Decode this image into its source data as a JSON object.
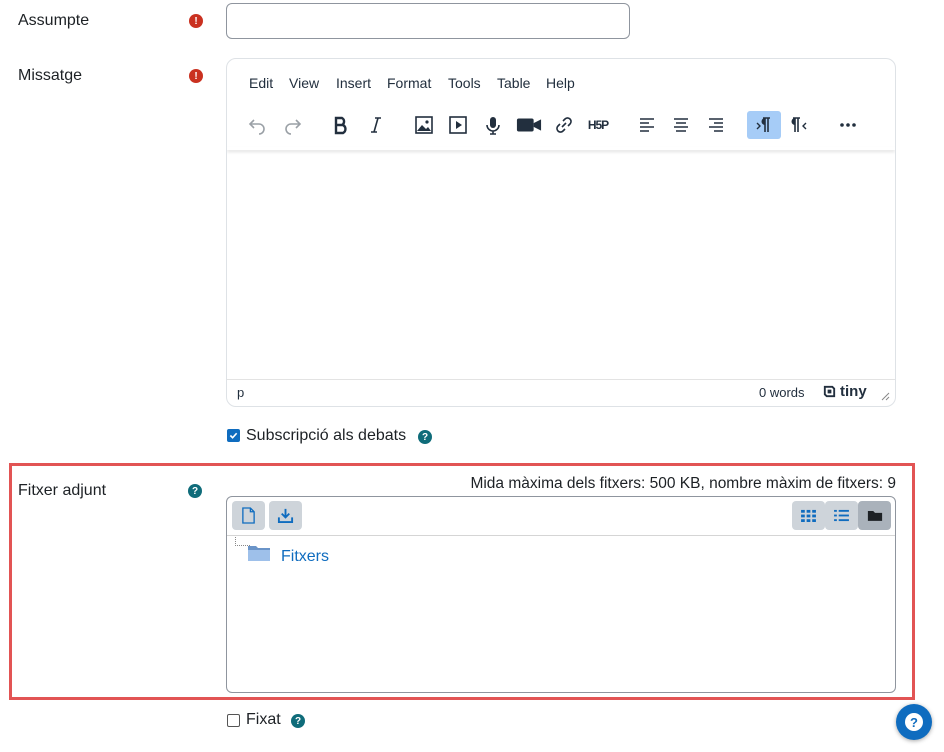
{
  "form": {
    "subject_label": "Assumpte",
    "subject_value": "",
    "message_label": "Missatge",
    "required_glyph": "!",
    "help_glyph": "?"
  },
  "editor": {
    "menu": [
      "Edit",
      "View",
      "Insert",
      "Format",
      "Tools",
      "Table",
      "Help"
    ],
    "toolbar_icons": [
      "undo-icon",
      "redo-icon",
      "bold-icon",
      "italic-icon",
      "image-icon",
      "media-icon",
      "record-audio-icon",
      "record-video-icon",
      "link-icon",
      "h5p-icon",
      "align-left-icon",
      "align-center-icon",
      "align-right-icon",
      "ltr-icon",
      "rtl-icon",
      "more-icon"
    ],
    "h5p_text": "H5P",
    "status_path": "p",
    "word_count": "0 words",
    "brand": "tiny"
  },
  "subscription": {
    "label": "Subscripció als debats",
    "checked": true
  },
  "attachment": {
    "label": "Fitxer adjunt",
    "limits_text": "Mida màxima dels fitxers: 500 KB, nombre màxim de fitxers: 9",
    "folder_name": "Fitxers",
    "views": [
      "icons-view",
      "list-view",
      "tree-view"
    ],
    "active_view": "tree-view"
  },
  "pinned": {
    "label": "Fixat",
    "checked": false
  },
  "colors": {
    "primary": "#0f6cbf",
    "required": "#ca3120",
    "highlight_border": "#e25454",
    "active_button": "#a6ccf7"
  }
}
